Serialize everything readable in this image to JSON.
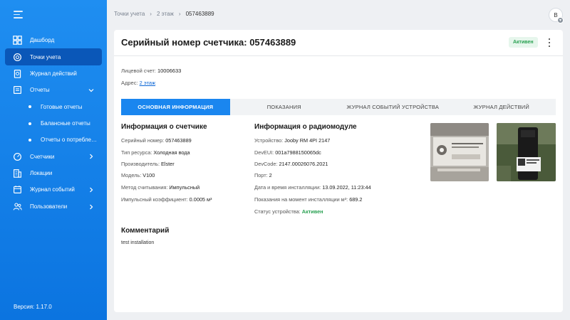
{
  "sidebar": {
    "items": [
      {
        "label": "Дашборд",
        "icon": "dashboard-icon"
      },
      {
        "label": "Точки учета",
        "icon": "meter-point-icon",
        "active": true
      },
      {
        "label": "Журнал действий",
        "icon": "journal-icon"
      },
      {
        "label": "Отчеты",
        "icon": "reports-icon",
        "expanded": true
      },
      {
        "label": "Счетчики",
        "icon": "counter-icon"
      },
      {
        "label": "Локации",
        "icon": "building-icon"
      },
      {
        "label": "Журнал событий",
        "icon": "calendar-icon"
      },
      {
        "label": "Пользователи",
        "icon": "users-icon"
      }
    ],
    "sub_items": [
      "Готовые отчеты",
      "Балансные отчеты",
      "Отчеты о потреблен..."
    ],
    "version": "Версия: 1.17.0"
  },
  "breadcrumb": {
    "items": [
      "Точки учета",
      "2 этаж",
      "057463889"
    ]
  },
  "user": {
    "initial": "B"
  },
  "page": {
    "title": "Серийный номер счетчика: 057463889",
    "status": "Активен",
    "account_label": "Лицевой счет:",
    "account_value": "10006633",
    "address_label": "Адрес:",
    "address_value": "2 этаж"
  },
  "tabs": [
    "ОСНОВНАЯ ИНФОРМАЦИЯ",
    "ПОКАЗАНИЯ",
    "ЖУРНАЛ СОБЫТИЙ УСТРОЙСТВА",
    "ЖУРНАЛ ДЕЙСТВИЙ"
  ],
  "meter_info": {
    "title": "Информация о счетчике",
    "fields": [
      {
        "label": "Серийный номер:",
        "value": "057463889"
      },
      {
        "label": "Тип ресурса:",
        "value": "Холодная вода"
      },
      {
        "label": "Производитель:",
        "value": "Elster"
      },
      {
        "label": "Модель:",
        "value": "V100"
      },
      {
        "label": "Метод считывания:",
        "value": "Импульсный"
      },
      {
        "label": "Импульсный коэффициент:",
        "value": "0.0005 м³"
      }
    ]
  },
  "radio_info": {
    "title": "Информация о радиомодуле",
    "fields": [
      {
        "label": "Устройство:",
        "value": "Jooby RM 4PI 2147"
      },
      {
        "label": "DevEUI:",
        "value": "001a7988150065dc"
      },
      {
        "label": "DevCode:",
        "value": "2147.00026076.2021"
      },
      {
        "label": "Порт:",
        "value": "2"
      },
      {
        "label": "Дата и время инсталляции:",
        "value": "13.09.2022, 11:23:44"
      },
      {
        "label": "Показания на момент инсталляции м³:",
        "value": "689.2"
      },
      {
        "label": "Статус устройства:",
        "value": "Активен"
      }
    ]
  },
  "comment": {
    "title": "Комментарий",
    "text": "test installation"
  },
  "colors": {
    "sidebar": "#0b74e0",
    "accent": "#1a86ef",
    "status_green": "#2aa152"
  }
}
